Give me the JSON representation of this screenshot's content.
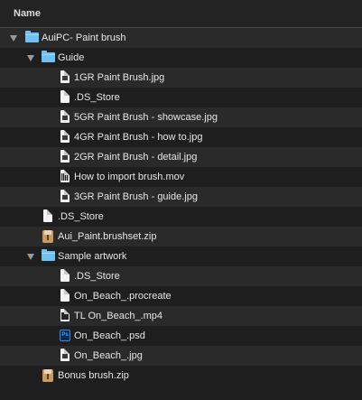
{
  "header": {
    "column_name": "Name"
  },
  "rows": [
    {
      "label": "AuiPC- Paint brush",
      "icon": "folder-icon",
      "expanded": true
    },
    {
      "label": "Guide",
      "icon": "folder-icon",
      "expanded": true
    },
    {
      "label": "1GR Paint Brush.jpg",
      "icon": "jpg-file-icon"
    },
    {
      "label": ".DS_Store",
      "icon": "document-icon"
    },
    {
      "label": "5GR Paint Brush - showcase.jpg",
      "icon": "jpg-file-icon"
    },
    {
      "label": "4GR Paint Brush - how to.jpg",
      "icon": "jpg-file-icon"
    },
    {
      "label": "2GR Paint Brush - detail.jpg",
      "icon": "jpg-file-icon"
    },
    {
      "label": "How to import brush.mov",
      "icon": "mov-file-icon"
    },
    {
      "label": "3GR Paint Brush - guide.jpg",
      "icon": "jpg-file-icon"
    },
    {
      "label": ".DS_Store",
      "icon": "document-icon"
    },
    {
      "label": "Aui_Paint.brushset.zip",
      "icon": "zip-archive-icon"
    },
    {
      "label": "Sample artwork",
      "icon": "folder-icon",
      "expanded": true
    },
    {
      "label": ".DS_Store",
      "icon": "document-icon"
    },
    {
      "label": "On_Beach_.procreate",
      "icon": "document-icon"
    },
    {
      "label": "TL On_Beach_.mp4",
      "icon": "mp4-file-icon"
    },
    {
      "label": "On_Beach_.psd",
      "icon": "photoshop-file-icon"
    },
    {
      "label": "On_Beach_.jpg",
      "icon": "jpg-file-icon"
    },
    {
      "label": "Bonus brush.zip",
      "icon": "zip-archive-icon"
    }
  ],
  "psd_badge": "Ps"
}
